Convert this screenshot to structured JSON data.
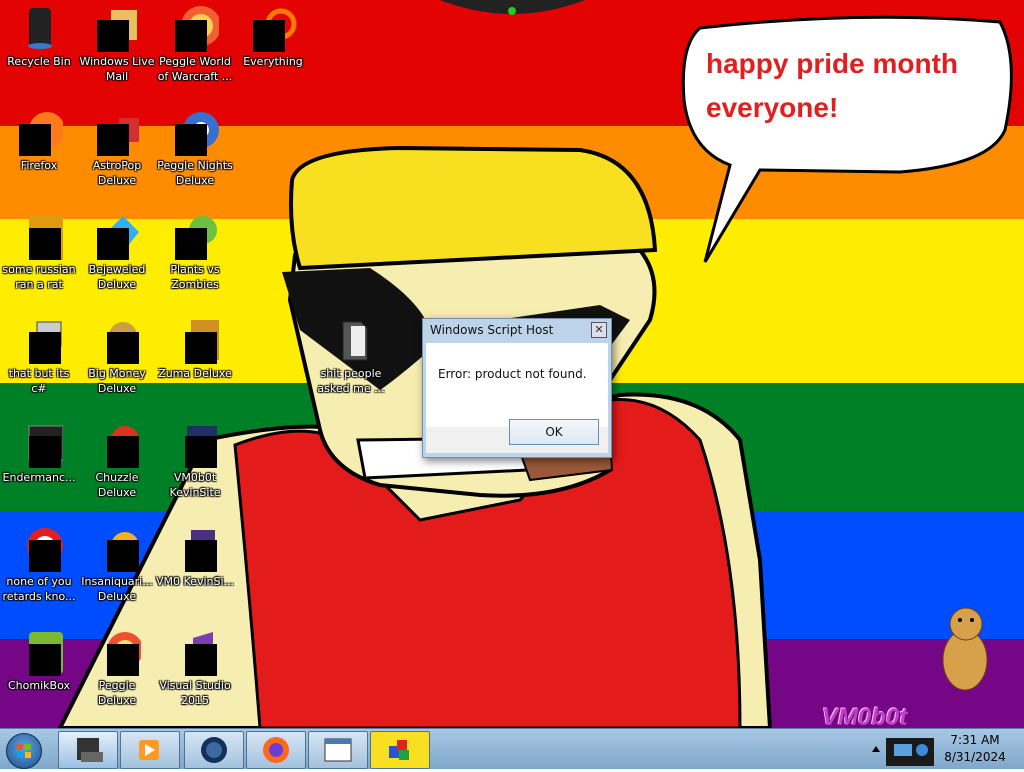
{
  "colors": {
    "band_red": "#e40303",
    "band_orange": "#ff8c00",
    "band_yellow": "#ffed00",
    "band_green": "#008026",
    "band_blue": "#004dff",
    "band_purple": "#750787"
  },
  "speech_bubble": {
    "line1": "happy pride month",
    "line2": "everyone!"
  },
  "desktop_icons": [
    {
      "label": "Recycle Bin",
      "icon": "recycle-bin-icon"
    },
    {
      "label": "Windows Live Mail",
      "icon": "mail-icon"
    },
    {
      "label": "Peggle World of Warcraft ...",
      "icon": "peggle-icon"
    },
    {
      "label": "Everything",
      "icon": "search-icon"
    },
    {
      "label": "Firefox",
      "icon": "firefox-icon"
    },
    {
      "label": "AstroPop Deluxe",
      "icon": "astropop-icon"
    },
    {
      "label": "Peggle Nights Deluxe",
      "icon": "peggle-nights-icon"
    },
    {
      "label": "some russian ran a rat",
      "icon": "app-icon"
    },
    {
      "label": "Bejeweled Deluxe",
      "icon": "bejeweled-icon"
    },
    {
      "label": "Plants vs Zombies",
      "icon": "pvz-icon"
    },
    {
      "label": "that but its c#",
      "icon": "shortcut-icon"
    },
    {
      "label": "Big Money Deluxe",
      "icon": "money-bag-icon"
    },
    {
      "label": "Zuma Deluxe",
      "icon": "zuma-icon"
    },
    {
      "label": "shit people asked me ...",
      "icon": "folder-icon"
    },
    {
      "label": "Endermanc...",
      "icon": "terminal-icon"
    },
    {
      "label": "Chuzzle Deluxe",
      "icon": "chuzzle-icon"
    },
    {
      "label": "VM0b0t KevinSite",
      "icon": "folder-icon"
    },
    {
      "label": "none of you retards kno...",
      "icon": "app-icon"
    },
    {
      "label": "Insaniquari... Deluxe",
      "icon": "insaniquarium-icon"
    },
    {
      "label": "VM0 KevinSi...",
      "icon": "file-icon"
    },
    {
      "label": "ChomikBox",
      "icon": "chomikbox-icon"
    },
    {
      "label": "Peggle Deluxe",
      "icon": "peggle-icon"
    },
    {
      "label": "Visual Studio 2015",
      "icon": "visual-studio-icon"
    }
  ],
  "dialog": {
    "title": "Windows Script Host",
    "close_glyph": "✕",
    "message": "Error: product not found.",
    "ok_label": "OK"
  },
  "watermark": "VM0b0t",
  "taskbar": {
    "buttons": [
      {
        "icon": "explorer-icon"
      },
      {
        "icon": "media-player-icon"
      },
      {
        "icon": "globe-icon"
      },
      {
        "icon": "firefox-icon"
      },
      {
        "icon": "window-icon"
      },
      {
        "icon": "paint-icon"
      }
    ]
  },
  "clock": {
    "time": "7:31 AM",
    "date": "8/31/2024"
  }
}
